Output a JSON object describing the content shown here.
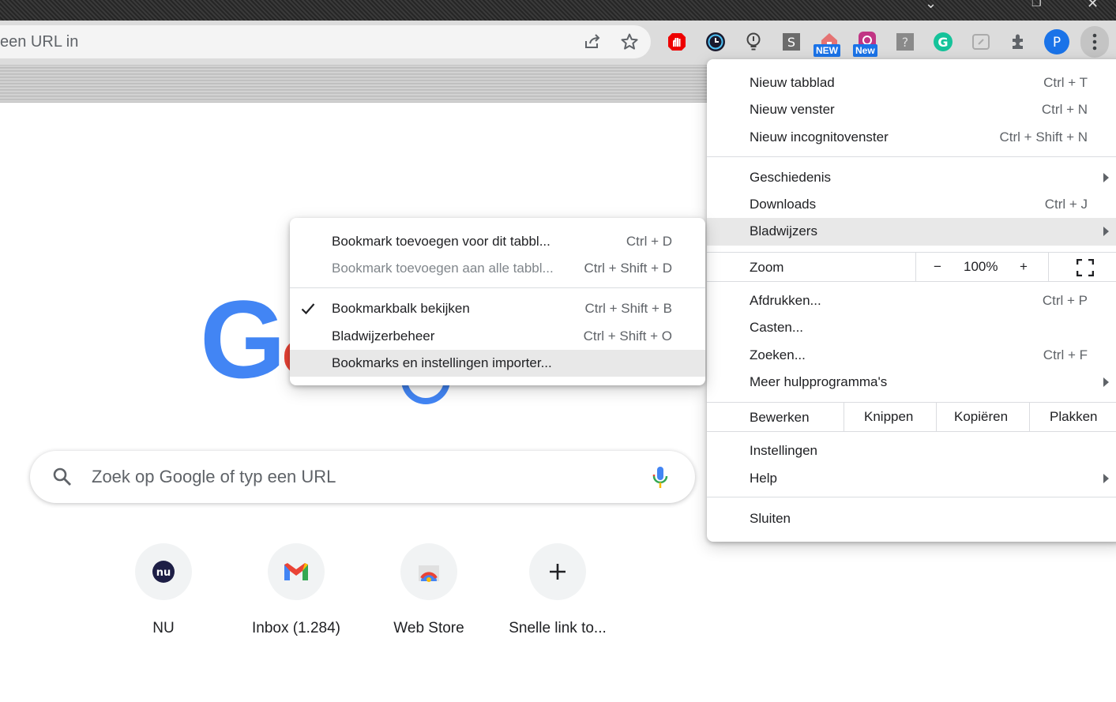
{
  "omnibox": {
    "text": "een URL in"
  },
  "toolbar": {
    "extensions": [
      "ublock-icon",
      "clock-icon",
      "bulb-icon",
      "s-icon",
      "home-icon",
      "instagram-icon",
      "question-icon",
      "grammarly-icon",
      "tab-icon",
      "puzzle-icon"
    ],
    "badge_new_1": "NEW",
    "badge_new_2": "New",
    "profile_letter": "P",
    "profile_color": "#1a73e8"
  },
  "search": {
    "placeholder": "Zoek op Google of typ een URL"
  },
  "shortcuts": [
    {
      "label": "NU"
    },
    {
      "label": "Inbox (1.284)"
    },
    {
      "label": "Web Store"
    },
    {
      "label": "Snelle link to..."
    }
  ],
  "main_menu": {
    "new_tab": {
      "label": "Nieuw tabblad",
      "shortcut": "Ctrl + T"
    },
    "new_window": {
      "label": "Nieuw venster",
      "shortcut": "Ctrl + N"
    },
    "new_incognito": {
      "label": "Nieuw incognitovenster",
      "shortcut": "Ctrl + Shift + N"
    },
    "history": {
      "label": "Geschiedenis"
    },
    "downloads": {
      "label": "Downloads",
      "shortcut": "Ctrl + J"
    },
    "bookmarks": {
      "label": "Bladwijzers"
    },
    "zoom": {
      "label": "Zoom",
      "minus": "−",
      "value": "100%",
      "plus": "+"
    },
    "print": {
      "label": "Afdrukken...",
      "shortcut": "Ctrl + P"
    },
    "cast": {
      "label": "Casten..."
    },
    "find": {
      "label": "Zoeken...",
      "shortcut": "Ctrl + F"
    },
    "more_tools": {
      "label": "Meer hulpprogramma's"
    },
    "edit": {
      "label": "Bewerken",
      "cut": "Knippen",
      "copy": "Kopiëren",
      "paste": "Plakken"
    },
    "settings": {
      "label": "Instellingen"
    },
    "help": {
      "label": "Help"
    },
    "exit": {
      "label": "Sluiten"
    }
  },
  "bookmarks_menu": {
    "add_this_tab": {
      "label": "Bookmark toevoegen voor dit tabbl...",
      "shortcut": "Ctrl + D"
    },
    "add_all_tabs": {
      "label": "Bookmark toevoegen aan alle tabbl...",
      "shortcut": "Ctrl + Shift + D"
    },
    "show_bar": {
      "label": "Bookmarkbalk bekijken",
      "shortcut": "Ctrl + Shift + B",
      "checked": true
    },
    "manager": {
      "label": "Bladwijzerbeheer",
      "shortcut": "Ctrl + Shift + O"
    },
    "import": {
      "label": "Bookmarks en instellingen importer..."
    }
  }
}
